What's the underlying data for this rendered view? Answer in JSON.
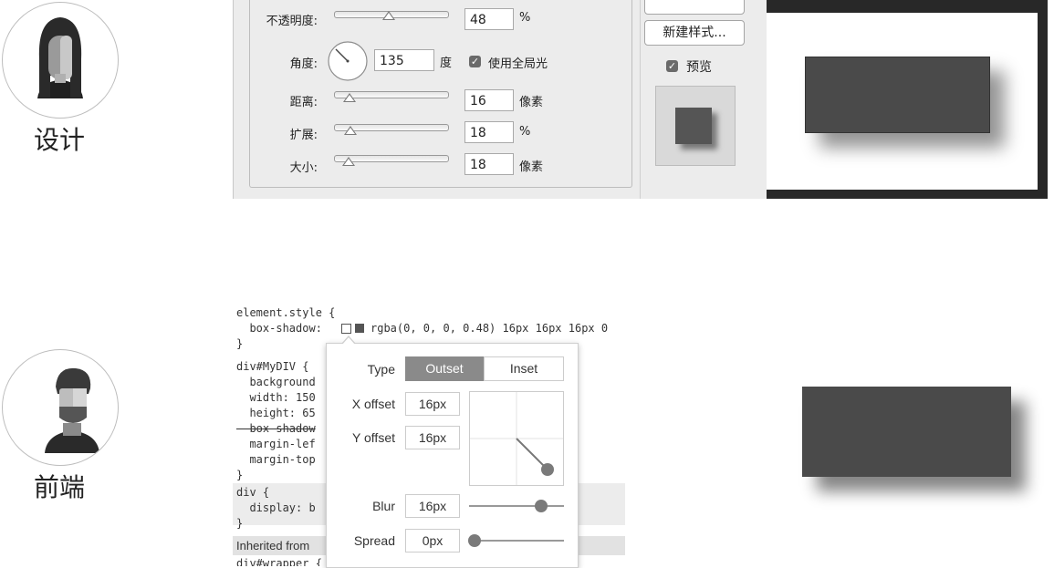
{
  "designer": {
    "label": "设计"
  },
  "frontend": {
    "label": "前端"
  },
  "ps": {
    "opacity": {
      "label": "不透明度:",
      "value": "48",
      "unit": "%"
    },
    "angle": {
      "label": "角度:",
      "value": "135",
      "unit": "度",
      "global_light_label": "使用全局光"
    },
    "distance": {
      "label": "距离:",
      "value": "16",
      "unit": "像素"
    },
    "spread": {
      "label": "扩展:",
      "value": "18",
      "unit": "%"
    },
    "size": {
      "label": "大小:",
      "value": "18",
      "unit": "像素"
    },
    "new_style_button": "新建样式...",
    "preview_label": "预览"
  },
  "devtools": {
    "lines": {
      "l1": "element.style {",
      "l2": "  box-shadow: ",
      "l2b": "rgba(0, 0, 0, 0.48) 16px 16px 16px 0",
      "l3": "}",
      "l4": "div#MyDIV {",
      "l5": "  background",
      "l6": "  width: 150",
      "l7": "  height: 65",
      "l8": "  box-shadow",
      "l9": "  margin-lef",
      "l10": "  margin-top",
      "l11": "}",
      "l12": "div {",
      "l13": "  display: b",
      "l14": "}",
      "l15": "Inherited from",
      "l16": "div#wrapper {"
    },
    "popup": {
      "type_label": "Type",
      "outset": "Outset",
      "inset": "Inset",
      "x_offset_label": "X offset",
      "x_offset": "16px",
      "y_offset_label": "Y offset",
      "y_offset": "16px",
      "blur_label": "Blur",
      "blur": "16px",
      "spread_label": "Spread",
      "spread": "0px"
    }
  },
  "colors": {
    "box": "#4a4a4a",
    "accent": "#8a8a8a"
  }
}
